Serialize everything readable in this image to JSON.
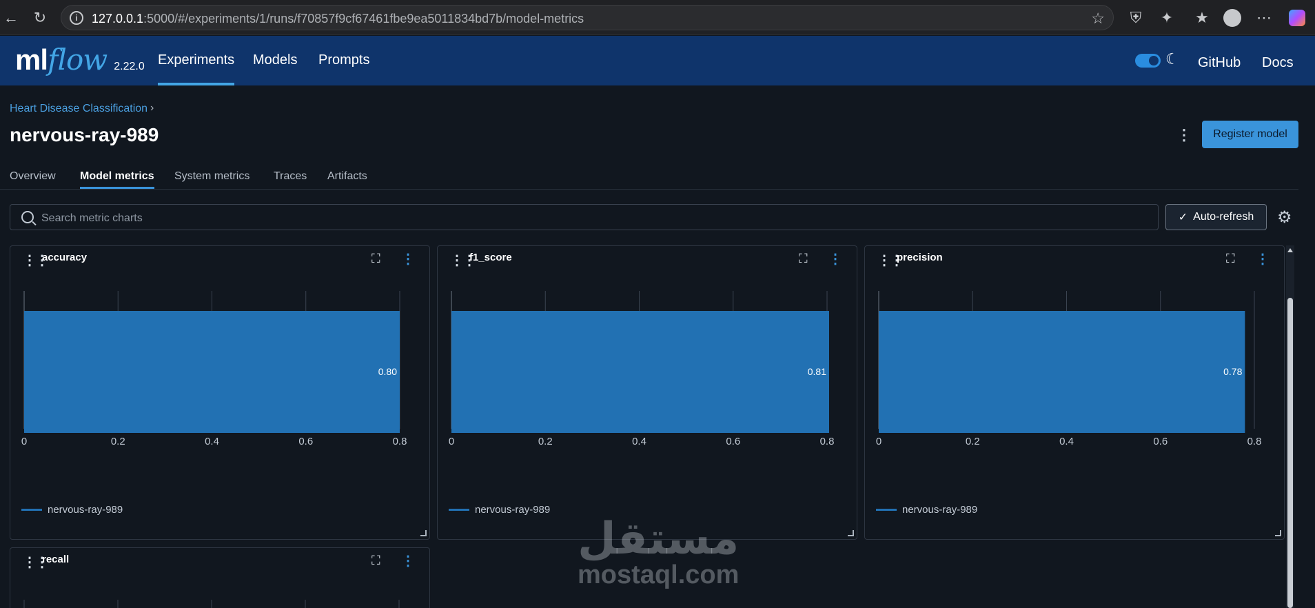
{
  "browser": {
    "url_host": "127.0.0.1",
    "url_rest": ":5000/#/experiments/1/runs/f70857f9cf67461fbe9ea5011834bd7b/model-metrics"
  },
  "header": {
    "logo_ml": "ml",
    "logo_flow": "flow",
    "version": "2.22.0",
    "nav": [
      "Experiments",
      "Models",
      "Prompts"
    ],
    "github": "GitHub",
    "docs": "Docs"
  },
  "page": {
    "breadcrumb": "Heart Disease Classification",
    "breadcrumb_sep": "›",
    "title": "nervous-ray-989",
    "register_button": "Register model",
    "tabs": [
      "Overview",
      "Model metrics",
      "System metrics",
      "Traces",
      "Artifacts"
    ],
    "active_tab": "Model metrics",
    "search_placeholder": "Search metric charts",
    "auto_refresh": "Auto-refresh"
  },
  "charts": [
    {
      "title": "accuracy",
      "legend": "nervous-ray-989",
      "value_label": "0.80"
    },
    {
      "title": "f1_score",
      "legend": "nervous-ray-989",
      "value_label": "0.81"
    },
    {
      "title": "precision",
      "legend": "nervous-ray-989",
      "value_label": "0.78"
    },
    {
      "title": "recall"
    }
  ],
  "chart_data": [
    {
      "type": "bar",
      "title": "accuracy",
      "categories": [
        "nervous-ray-989"
      ],
      "values": [
        0.8
      ],
      "xticks": [
        "0",
        "0.2",
        "0.4",
        "0.6",
        "0.8"
      ],
      "xlim": [
        0,
        0.8
      ],
      "orientation": "horizontal",
      "color": "#2271b3",
      "legend": "bottom-left"
    },
    {
      "type": "bar",
      "title": "f1_score",
      "categories": [
        "nervous-ray-989"
      ],
      "values": [
        0.81
      ],
      "xticks": [
        "0",
        "0.2",
        "0.4",
        "0.6",
        "0.8"
      ],
      "xlim": [
        0,
        0.8
      ],
      "orientation": "horizontal",
      "color": "#2271b3",
      "legend": "bottom-left"
    },
    {
      "type": "bar",
      "title": "precision",
      "categories": [
        "nervous-ray-989"
      ],
      "values": [
        0.78
      ],
      "xticks": [
        "0",
        "0.2",
        "0.4",
        "0.6",
        "0.8"
      ],
      "xlim": [
        0,
        0.8
      ],
      "orientation": "horizontal",
      "color": "#2271b3",
      "legend": "bottom-left"
    }
  ],
  "watermark": {
    "arabic": "مستقل",
    "latin": "mostaql.com"
  },
  "colors": {
    "header_bg": "#0f346b",
    "accent": "#3a94db",
    "bar": "#2271b3",
    "page_bg": "#11171f"
  }
}
